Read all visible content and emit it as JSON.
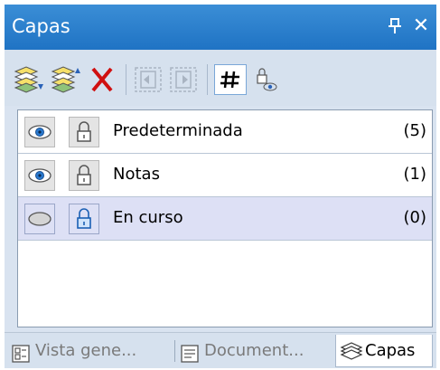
{
  "panel": {
    "title": "Capas"
  },
  "toolbar": {
    "items": [
      {
        "icon": "layers-down-icon"
      },
      {
        "icon": "layers-up-icon"
      },
      {
        "icon": "delete-x-icon"
      },
      {
        "icon": "move-left-icon"
      },
      {
        "icon": "move-right-icon"
      },
      {
        "icon": "grid-toggle-icon"
      },
      {
        "icon": "lock-view-icon"
      }
    ]
  },
  "layers": [
    {
      "name": "Predeterminada",
      "count": "(5)",
      "visible": true,
      "locked": false,
      "selected": false
    },
    {
      "name": "Notas",
      "count": "(1)",
      "visible": true,
      "locked": false,
      "selected": false
    },
    {
      "name": "En curso",
      "count": "(0)",
      "visible": false,
      "locked": true,
      "selected": true
    }
  ],
  "tabs": [
    {
      "label": "Vista gene...",
      "icon": "overview-icon",
      "active": false
    },
    {
      "label": "Document...",
      "icon": "document-icon",
      "active": false
    },
    {
      "label": "Capas",
      "icon": "layers-icon",
      "active": true
    }
  ],
  "colors": {
    "title_bar": "#1f73c4",
    "selected_row": "#dde0f5",
    "delete": "#d01010"
  }
}
